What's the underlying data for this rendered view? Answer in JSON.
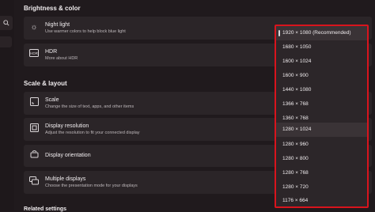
{
  "sections": {
    "brightness_color": "Brightness & color",
    "scale_layout": "Scale & layout",
    "related": "Related settings"
  },
  "cards": {
    "night_light": {
      "title": "Night light",
      "subtitle": "Use warmer colors to help block blue light"
    },
    "hdr": {
      "title": "HDR",
      "subtitle": "More about HDR"
    },
    "scale": {
      "title": "Scale",
      "subtitle": "Change the size of text, apps, and other items"
    },
    "display_resolution": {
      "title": "Display resolution",
      "subtitle": "Adjust the resolution to fit your connected display"
    },
    "display_orientation": {
      "title": "Display orientation",
      "subtitle": ""
    },
    "multiple_displays": {
      "title": "Multiple displays",
      "subtitle": "Choose the presentation mode for your displays"
    }
  },
  "resolution_dropdown": {
    "selected": "1920 × 1080 (Recommended)",
    "options": [
      "1920 × 1080 (Recommended)",
      "1680 × 1050",
      "1600 × 1024",
      "1600 × 900",
      "1440 × 1080",
      "1366 × 768",
      "1360 × 768",
      "1280 × 1024",
      "1280 × 960",
      "1280 × 800",
      "1280 × 768",
      "1280 × 720",
      "1176 × 664"
    ],
    "highlight_color": "#d8141d"
  },
  "icons": {
    "search": "search-icon",
    "night_light": "sun-icon",
    "hdr": "hdr-icon",
    "scale": "scale-icon",
    "display_resolution": "display-icon",
    "display_orientation": "rotate-icon",
    "multiple_displays": "multiple-displays-icon"
  }
}
